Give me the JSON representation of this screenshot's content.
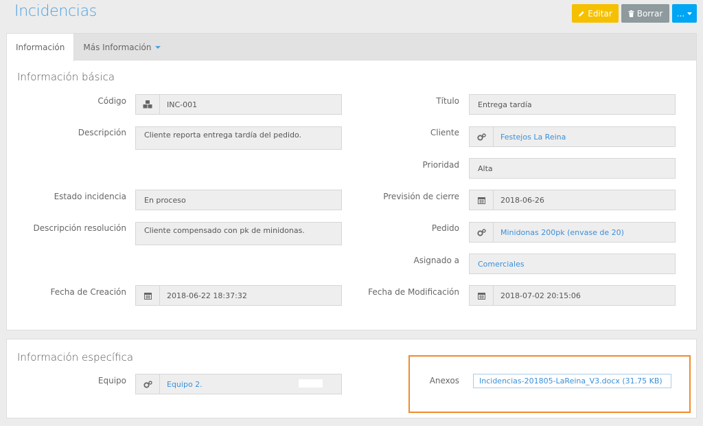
{
  "page": {
    "title": "Incidencias"
  },
  "actions": {
    "edit": "Editar",
    "delete": "Borrar",
    "more": "..."
  },
  "tabs": [
    {
      "label": "Información"
    },
    {
      "label": "Más Información"
    }
  ],
  "basic": {
    "title": "Información básica",
    "codigo": {
      "label": "Código",
      "value": "INC-001"
    },
    "titulo": {
      "label": "Título",
      "value": "Entrega tardía"
    },
    "descripcion": {
      "label": "Descripción",
      "value": "Cliente reporta entrega tardía del pedido."
    },
    "cliente": {
      "label": "Cliente",
      "value": "Festejos La Reina"
    },
    "prioridad": {
      "label": "Prioridad",
      "value": "Alta"
    },
    "estado": {
      "label": "Estado incidencia",
      "value": "En proceso"
    },
    "prevision": {
      "label": "Previsión de cierre",
      "value": "2018-06-26"
    },
    "resolucion": {
      "label": "Descripción resolución",
      "value": "Cliente compensado con pk de minidonas."
    },
    "pedido": {
      "label": "Pedido",
      "value": "Minidonas 200pk (envase de 20)"
    },
    "asignado": {
      "label": "Asignado a",
      "value": "Comerciales"
    },
    "creacion": {
      "label": "Fecha de Creación",
      "value": "2018-06-22 18:37:32"
    },
    "modificacion": {
      "label": "Fecha de Modificación",
      "value": "2018-07-02 20:15:06"
    }
  },
  "specific": {
    "title": "Información específica",
    "equipo": {
      "label": "Equipo",
      "value": "Equipo 2."
    },
    "anexos": {
      "label": "Anexos",
      "value": "Incidencias-201805-LaReina_V3.docx (31.75 KB)"
    }
  },
  "colors": {
    "accent": "#4a9fe0",
    "edit": "#f5c000",
    "delete": "#8e9a9d",
    "more": "#00a6f4",
    "highlight": "#f08a2c"
  }
}
